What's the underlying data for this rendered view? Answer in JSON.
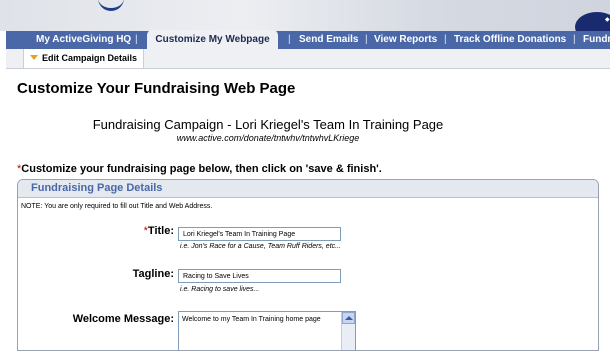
{
  "nav": {
    "items": [
      {
        "label": "My ActiveGiving HQ"
      },
      {
        "label": "Customize My Webpage"
      },
      {
        "label": "Send Emails"
      },
      {
        "label": "View Reports"
      },
      {
        "label": "Track Offline Donations"
      },
      {
        "label": "Fundr"
      }
    ],
    "separator": "|",
    "active_index": 1
  },
  "subnav": {
    "active_tab": "Edit Campaign Details"
  },
  "page": {
    "title": "Customize Your Fundraising Web Page",
    "campaign_title": "Fundraising Campaign - Lori Kriegel's Team In Training Page",
    "campaign_url": "www.active.com/donate/tntwhv/tntwhvLKriege",
    "instructions_marker": "*",
    "instructions": "Customize your fundraising page below, then click on 'save & finish'."
  },
  "details": {
    "heading": "Fundraising Page Details",
    "note": "NOTE: You are only required to fill out Title and Web Address.",
    "title_field": {
      "required_marker": "*",
      "label": "Title:",
      "value": "Lori Kriegel's Team In Training Page",
      "hint": "i.e. Jon's Race for a Cause, Team Ruff Riders, etc..."
    },
    "tagline_field": {
      "label": "Tagline:",
      "value": "Racing to Save Lives",
      "hint": "i.e. Racing to save lives..."
    },
    "welcome_field": {
      "label": "Welcome Message:",
      "value": "Welcome to my Team In Training home page"
    }
  },
  "colors": {
    "nav_bg": "#4a67a8",
    "required": "#cc0000",
    "panel_heading": "#4a67a8"
  }
}
